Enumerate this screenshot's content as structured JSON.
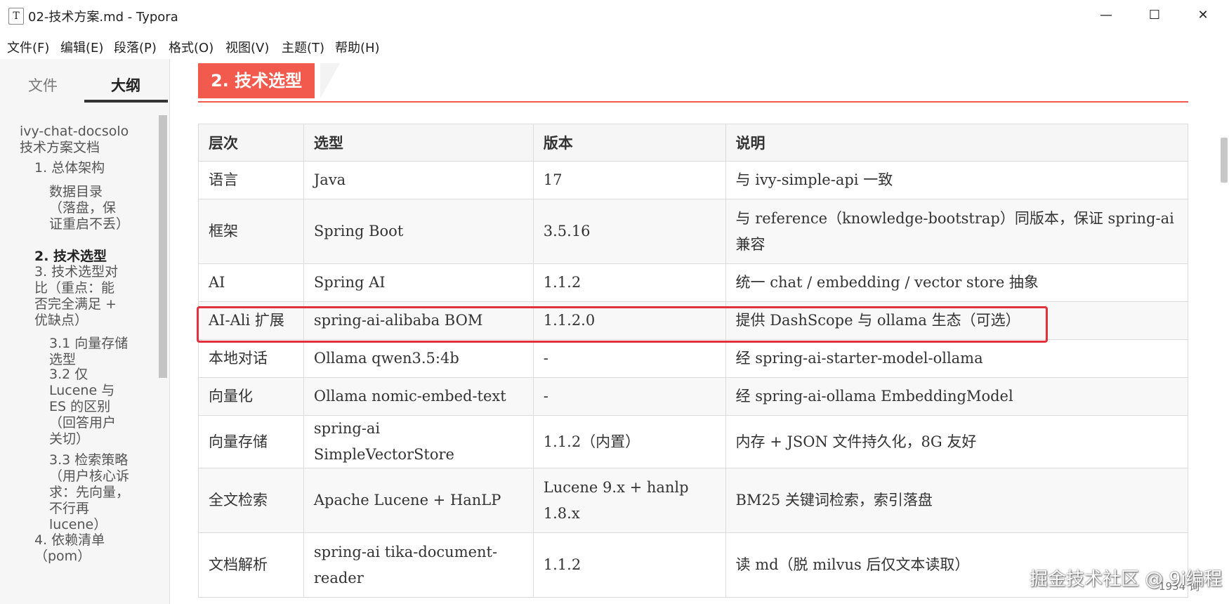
{
  "window": {
    "app_icon": "T",
    "title": "02-技术方案.md - Typora",
    "minimize_icon": "—",
    "maximize_icon": "☐",
    "close_icon": "✕"
  },
  "menu": [
    "文件(F)",
    "编辑(E)",
    "段落(P)",
    "格式(O)",
    "视图(V)",
    "主题(T)",
    "帮助(H)"
  ],
  "sidebar": {
    "tabs": [
      "文件",
      "大纲"
    ],
    "active_tab": "大纲",
    "outline": [
      {
        "text": "ivy-chat-docsolo 技术方案文档",
        "level": 1
      },
      {
        "text": "1. 总体架构",
        "level": 2
      },
      {
        "text": "数据目录（落盘，保证重启不丢）",
        "level": 3
      },
      {
        "text": "2. 技术选型",
        "level": 2,
        "active": true
      },
      {
        "text": "3. 技术选型对比（重点：能否完全满足 + 优缺点）",
        "level": 2
      },
      {
        "text": "3.1 向量存储选型",
        "level": 3
      },
      {
        "text": "3.2 仅 Lucene 与 ES 的区别（回答用户关切）",
        "level": 3
      },
      {
        "text": "3.3 检索策略（用户核心诉求：先向量，不行再 lucene）",
        "level": 3
      },
      {
        "text": "4. 依赖清单（pom）",
        "level": 2
      }
    ],
    "bottom_left_icon": "‹",
    "bottom_code_icon": "</>"
  },
  "document": {
    "heading": "2. 技术选型",
    "table": {
      "headers": [
        "层次",
        "选型",
        "版本",
        "说明"
      ],
      "rows": [
        [
          "语言",
          "Java",
          "17",
          "与 ivy-simple-api 一致"
        ],
        [
          "框架",
          "Spring Boot",
          "3.5.16",
          "与 reference（knowledge-bootstrap）同版本，保证 spring-ai 兼容"
        ],
        [
          "AI",
          "Spring AI",
          "1.1.2",
          "统一 chat / embedding / vector store 抽象"
        ],
        [
          "AI-Ali 扩展",
          "spring-ai-alibaba BOM",
          "1.1.2.0",
          "提供 DashScope 与 ollama 生态（可选）"
        ],
        [
          "本地对话",
          "Ollama qwen3.5:4b",
          "-",
          "经 spring-ai-starter-model-ollama"
        ],
        [
          "向量化",
          "Ollama nomic-embed-text",
          "-",
          "经 spring-ai-ollama EmbeddingModel"
        ],
        [
          "向量存储",
          "spring-ai SimpleVectorStore",
          "1.1.2（内置）",
          "内存 + JSON 文件持久化，8G 友好"
        ],
        [
          "全文检索",
          "Apache Lucene + HanLP",
          "Lucene 9.x + hanlp 1.8.x",
          "BM25 关键词检索，索引落盘"
        ],
        [
          "文档解析",
          "spring-ai tika-document-reader",
          "1.1.2",
          "读 md（脱 milvus 后仅文本读取）"
        ]
      ],
      "highlighted_row": 3
    }
  },
  "status": {
    "watermark": "掘金技术社区 @ 9i编程",
    "word_count": "1934 词"
  }
}
